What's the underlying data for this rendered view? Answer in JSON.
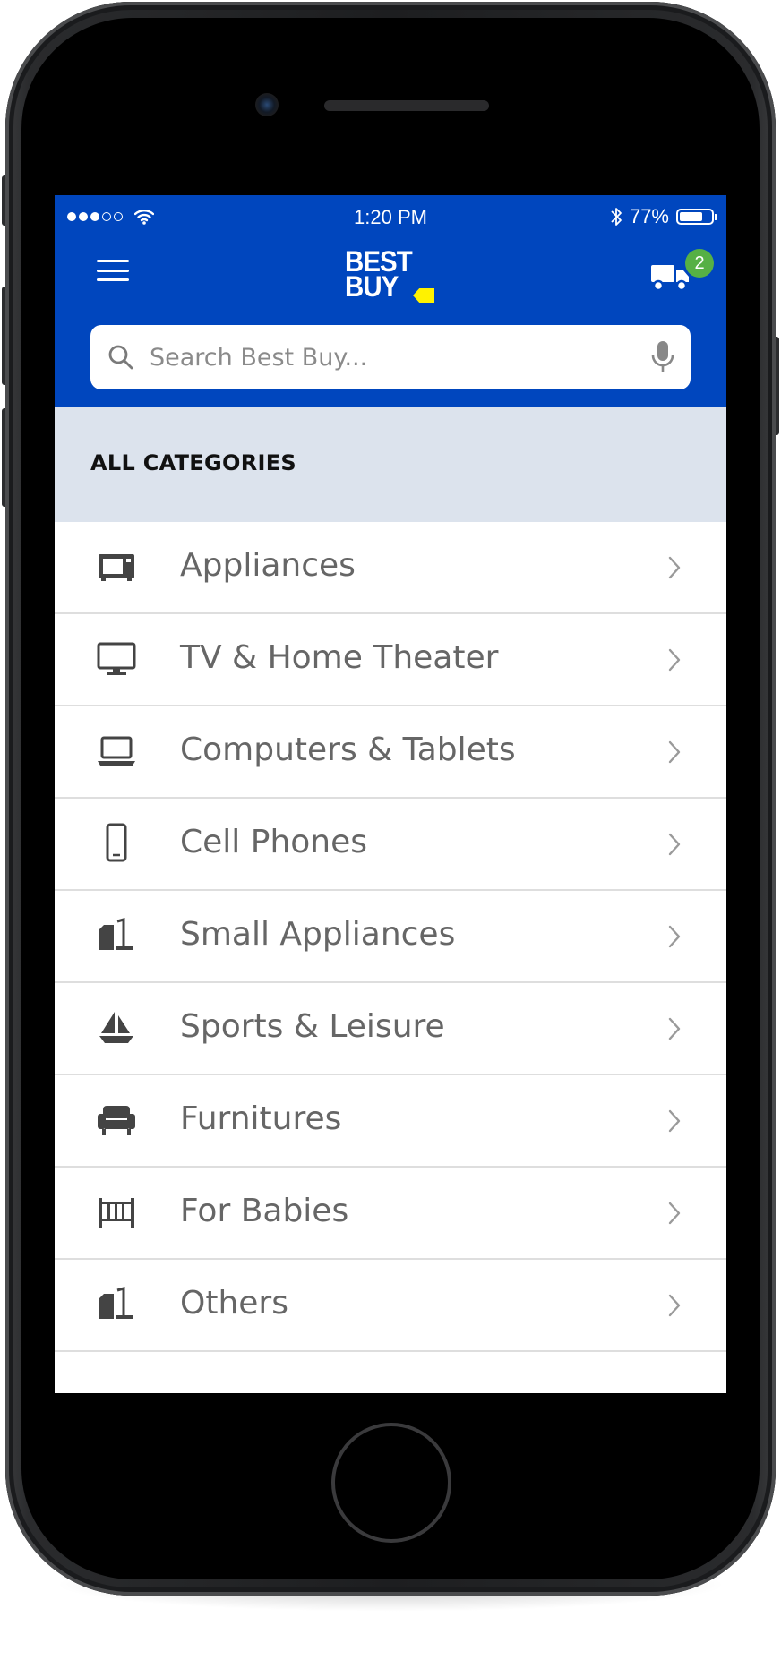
{
  "status_bar": {
    "time": "1:20 PM",
    "battery": "77%",
    "battery_level": 0.77
  },
  "header": {
    "logo_line1": "BEST",
    "logo_line2": "BUY",
    "cart_count": "2",
    "brand_color": "#0046be",
    "tag_color": "#fff200",
    "badge_color": "#56b045"
  },
  "search": {
    "placeholder": "Search Best Buy...",
    "value": ""
  },
  "section": {
    "title": "ALL CATEGORIES"
  },
  "categories": [
    {
      "label": "Appliances",
      "icon": "microwave-icon"
    },
    {
      "label": "TV & Home Theater",
      "icon": "monitor-icon"
    },
    {
      "label": "Computers & Tablets",
      "icon": "laptop-icon"
    },
    {
      "label": "Cell Phones",
      "icon": "phone-icon"
    },
    {
      "label": "Small Appliances",
      "icon": "small-appliance-icon"
    },
    {
      "label": "Sports & Leisure",
      "icon": "sailboat-icon"
    },
    {
      "label": "Furnitures",
      "icon": "sofa-icon"
    },
    {
      "label": "For Babies",
      "icon": "crib-icon"
    },
    {
      "label": "Others",
      "icon": "small-appliance-icon"
    }
  ]
}
